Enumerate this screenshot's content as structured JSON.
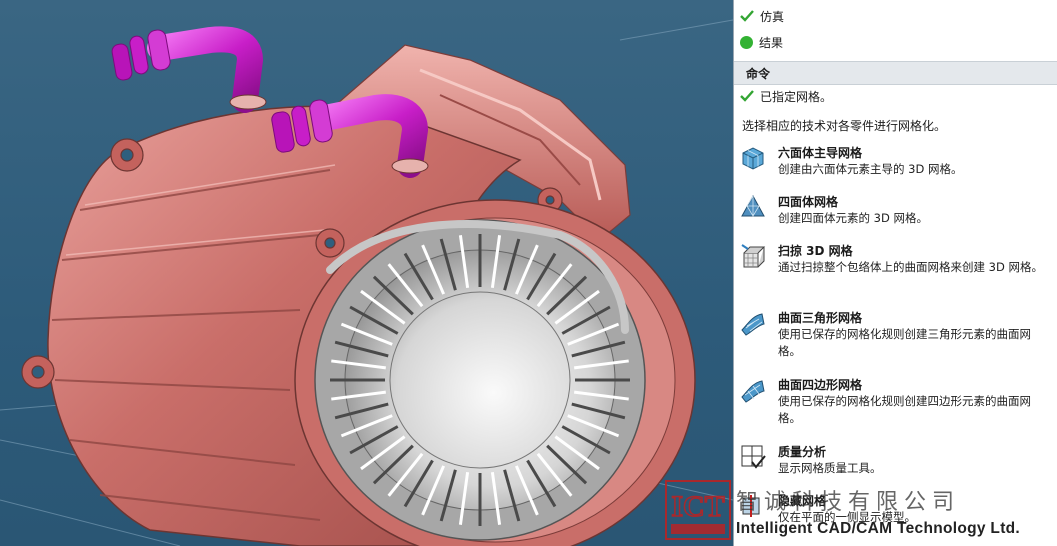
{
  "panel": {
    "status_items": [
      {
        "label": "仿真",
        "icon": "check-icon",
        "color": "#33a533"
      },
      {
        "label": "结果",
        "icon": "green-dot-icon",
        "color": "#33b233"
      }
    ],
    "section_title": "命令",
    "assigned_text": "已指定网格。",
    "intro_text": "选择相应的技术对各零件进行网格化。",
    "commands": [
      {
        "title": "六面体主导网格",
        "desc": "创建由六面体元素主导的 3D 网格。",
        "icon": "hex-mesh-icon"
      },
      {
        "title": "四面体网格",
        "desc": "创建四面体元素的 3D 网格。",
        "icon": "tet-mesh-icon"
      },
      {
        "title": "扫掠 3D 网格",
        "desc": "通过扫掠整个包络体上的曲面网格来创建 3D 网格。",
        "icon": "sweep-mesh-icon"
      },
      {
        "title": "曲面三角形网格",
        "desc": "使用已保存的网格化规则创建三角形元素的曲面网格。",
        "icon": "surface-tri-mesh-icon"
      },
      {
        "title": "曲面四边形网格",
        "desc": "使用已保存的网格化规则创建四边形元素的曲面网格。",
        "icon": "surface-quad-mesh-icon"
      },
      {
        "title": "质量分析",
        "desc": "显示网格质量工具。",
        "icon": "quality-analysis-icon"
      },
      {
        "title": "隐藏网格",
        "desc": "仅在平面的一侧显示模型。",
        "icon": "section-view-icon"
      }
    ]
  },
  "watermark": {
    "logo_text": "ICT",
    "cn_text": "智诚科技有限公司",
    "en_text": "Intelligent CAD/CAM Technology Ltd."
  },
  "colors": {
    "housing": "#c9706c",
    "pipe": "#c81ec8",
    "stator": "#b8b8b8",
    "background": "#2f5f7e",
    "accent_green": "#33a533"
  }
}
